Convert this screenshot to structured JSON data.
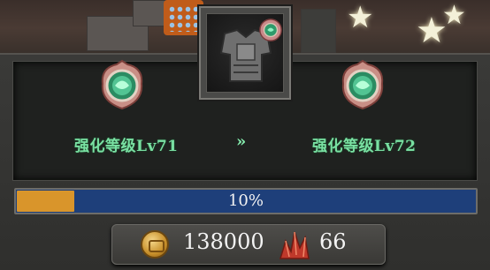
{
  "enhance": {
    "current_level": "强化等级Lv71",
    "next_level": "强化等级Lv72",
    "arrow": "»",
    "progress_text": "10%",
    "progress_fraction": 0.1
  },
  "cost": {
    "gold": "138000",
    "crystal": "66"
  },
  "icons": {
    "equipment": "armor-chestplate-icon",
    "emblem": "green-gem-emblem-icon",
    "gold": "gold-coin-icon",
    "crystal": "red-crystal-icon"
  },
  "colors": {
    "level_text": "#79e0a2",
    "bar_fill": "#d9952b",
    "bar_track": "#1e3f7a"
  }
}
